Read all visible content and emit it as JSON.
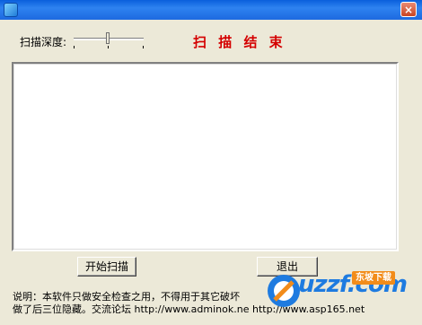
{
  "window": {
    "title": "",
    "close_glyph": "×"
  },
  "scan": {
    "depth_label": "扫描深度:",
    "status_text": "扫 描 结 束",
    "status_color": "#D40000"
  },
  "buttons": {
    "start_label": "开始扫描",
    "exit_label": "退出"
  },
  "notice": {
    "line1": "说明：本软件只做安全检查之用，不得用于其它破坏",
    "line2": "做了后三位隐藏。交流论坛 http://www.adminok.ne  http://www.asp165.net"
  },
  "watermark": {
    "text": "uzzf.com",
    "badge": "东坡下载"
  }
}
